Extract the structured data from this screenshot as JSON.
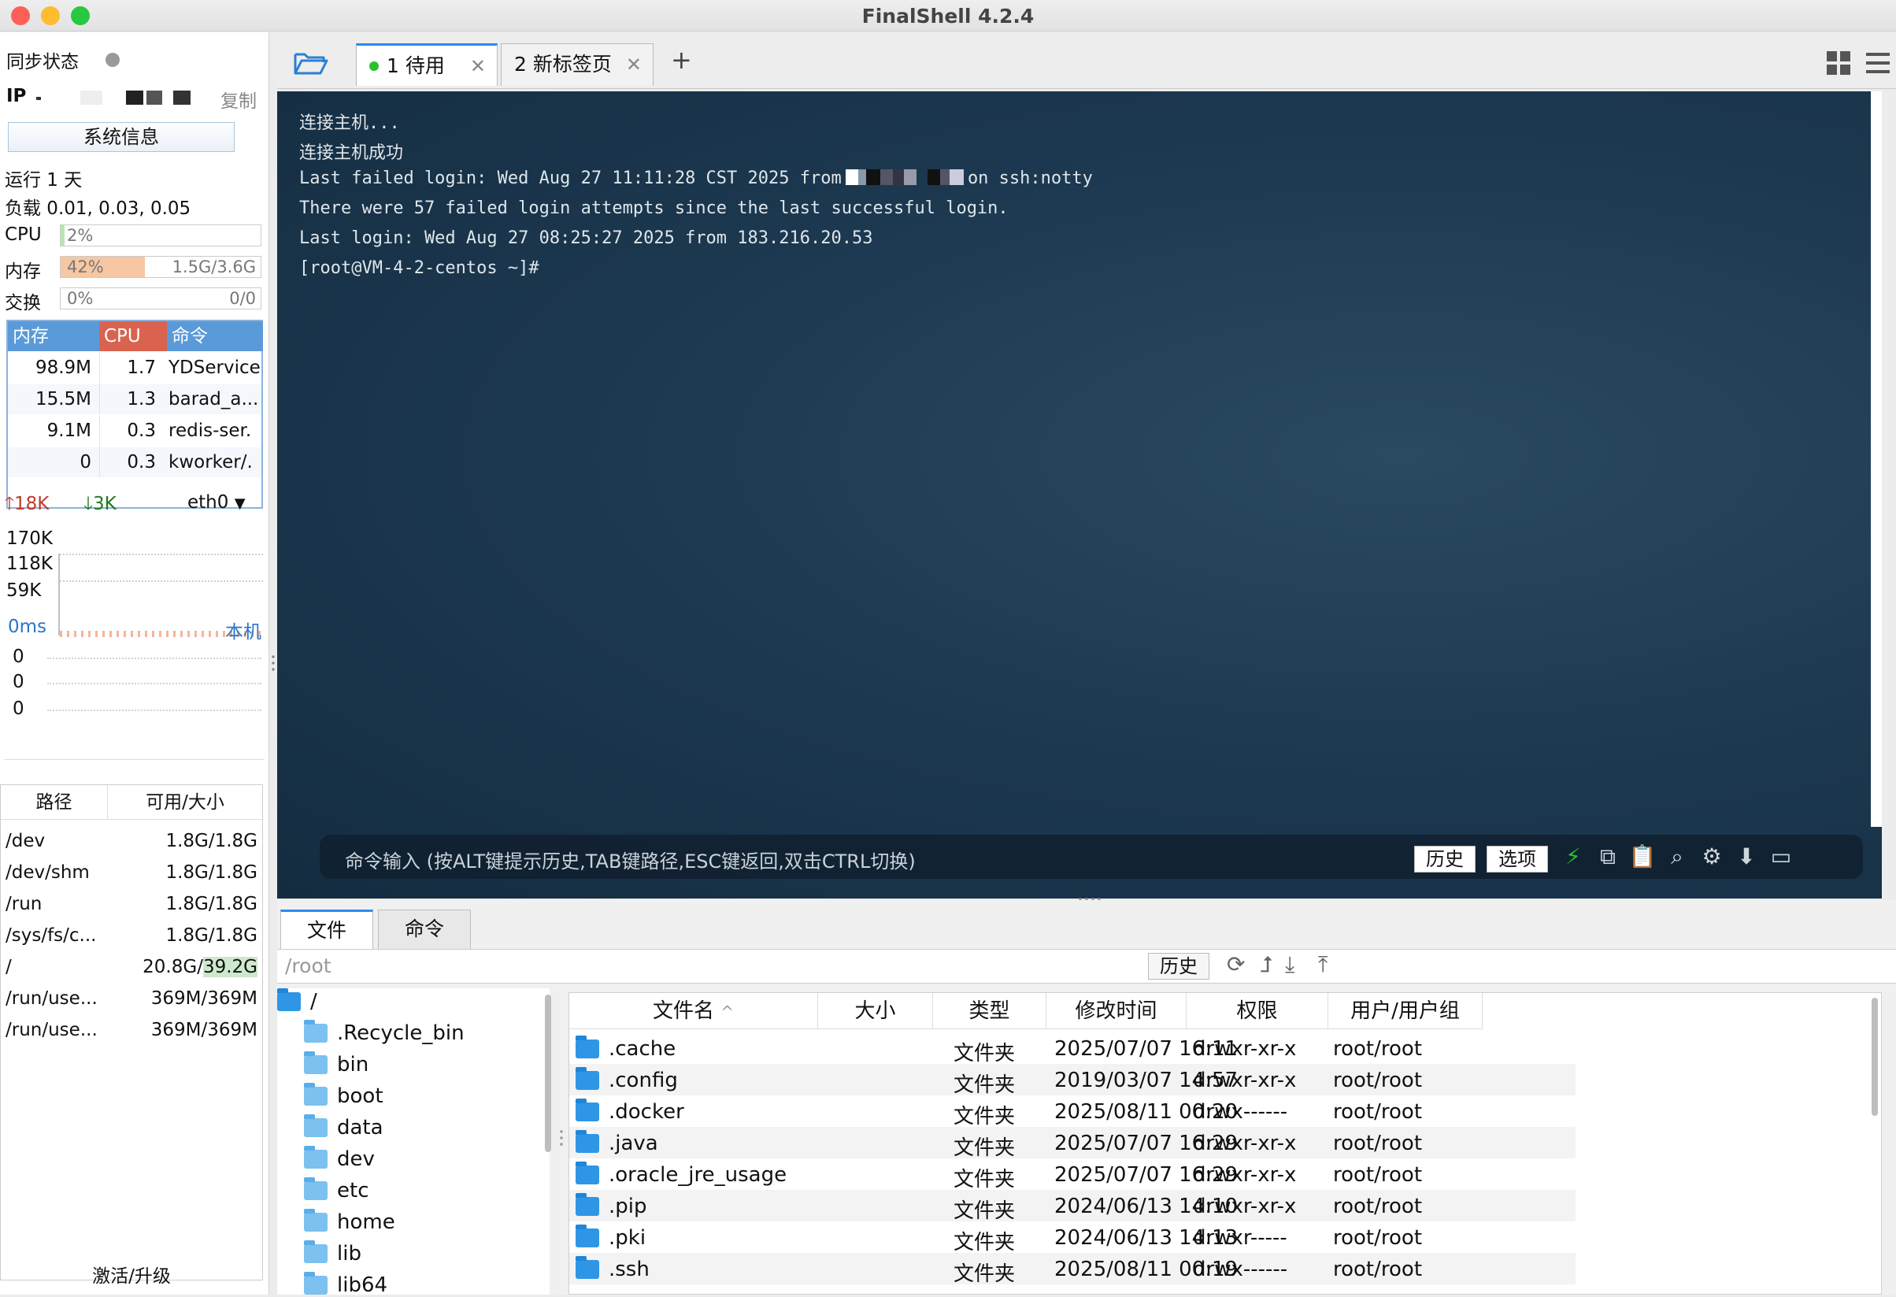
{
  "window": {
    "title": "FinalShell 4.2.4"
  },
  "sidebar": {
    "sync_label": "同步状态",
    "ip_label": "IP",
    "copy_label": "复制",
    "sysinfo_label": "系统信息",
    "uptime": "运行 1 天",
    "load": "负载 0.01, 0.03, 0.05",
    "cpu": {
      "label": "CPU",
      "value": "2%",
      "fraction": 0.02
    },
    "mem": {
      "label": "内存",
      "value": "42%",
      "detail": "1.5G/3.6G",
      "fraction": 0.42
    },
    "swap": {
      "label": "交换",
      "value": "0%",
      "detail": "0/0",
      "fraction": 0
    },
    "process_table": {
      "headers": [
        "内存",
        "CPU",
        "命令"
      ],
      "rows": [
        {
          "mem": "98.9M",
          "cpu": "1.7",
          "cmd": "YDService"
        },
        {
          "mem": "15.5M",
          "cpu": "1.3",
          "cmd": "barad_a..."
        },
        {
          "mem": "9.1M",
          "cpu": "0.3",
          "cmd": "redis-ser."
        },
        {
          "mem": "0",
          "cpu": "0.3",
          "cmd": "kworker/."
        }
      ]
    },
    "net": {
      "up": "18K",
      "down": "3K",
      "iface": "eth0",
      "scale": [
        "170K",
        "118K",
        "59K"
      ]
    },
    "ping": {
      "latency": "0ms",
      "target": "本机",
      "values": [
        "0",
        "0",
        "0"
      ]
    },
    "disk_table": {
      "headers": [
        "路径",
        "可用/大小"
      ],
      "rows": [
        {
          "path": "/dev",
          "size": "1.8G/1.8G"
        },
        {
          "path": "/dev/shm",
          "size": "1.8G/1.8G"
        },
        {
          "path": "/run",
          "size": "1.8G/1.8G"
        },
        {
          "path": "/sys/fs/c...",
          "size": "1.8G/1.8G"
        },
        {
          "path": "/",
          "size_a": "20.8G/",
          "size_b": "39.2G"
        },
        {
          "path": "/run/use...",
          "size": "369M/369M"
        },
        {
          "path": "/run/use...",
          "size": "369M/369M"
        }
      ]
    },
    "activate_label": "激活/升级"
  },
  "tabs": [
    {
      "label": "1 待用"
    },
    {
      "label": "2 新标签页"
    }
  ],
  "terminal": {
    "lines": [
      "连接主机...",
      "连接主机成功",
      "Last failed login: Wed Aug 27 11:11:28 CST 2025 from",
      "on ssh:notty",
      "There were 57 failed login attempts since the last successful login.",
      "Last login: Wed Aug 27 08:25:27 2025 from 183.216.20.53",
      "[root@VM-4-2-centos ~]#"
    ],
    "command_placeholder": "命令输入 (按ALT键提示历史,TAB键路径,ESC键返回,双击CTRL切换)",
    "history_button": "历史",
    "options_button": "选项"
  },
  "bottom": {
    "tabs": [
      "文件",
      "命令"
    ],
    "path": "/root",
    "history_button": "历史",
    "tree": [
      {
        "name": "/"
      },
      {
        "name": ".Recycle_bin"
      },
      {
        "name": "bin"
      },
      {
        "name": "boot"
      },
      {
        "name": "data"
      },
      {
        "name": "dev"
      },
      {
        "name": "etc"
      },
      {
        "name": "home"
      },
      {
        "name": "lib"
      },
      {
        "name": "lib64"
      }
    ],
    "file_headers": [
      "文件名",
      "大小",
      "类型",
      "修改时间",
      "权限",
      "用户/用户组"
    ],
    "files": [
      {
        "name": ".cache",
        "size": "",
        "type": "文件夹",
        "mtime": "2025/07/07 16:11",
        "perm": "drwxr-xr-x",
        "owner": "root/root"
      },
      {
        "name": ".config",
        "size": "",
        "type": "文件夹",
        "mtime": "2019/03/07 14:57",
        "perm": "drwxr-xr-x",
        "owner": "root/root"
      },
      {
        "name": ".docker",
        "size": "",
        "type": "文件夹",
        "mtime": "2025/08/11 00:20",
        "perm": "drwx------",
        "owner": "root/root"
      },
      {
        "name": ".java",
        "size": "",
        "type": "文件夹",
        "mtime": "2025/07/07 16:29",
        "perm": "drwxr-xr-x",
        "owner": "root/root"
      },
      {
        "name": ".oracle_jre_usage",
        "size": "",
        "type": "文件夹",
        "mtime": "2025/07/07 16:29",
        "perm": "drwxr-xr-x",
        "owner": "root/root"
      },
      {
        "name": ".pip",
        "size": "",
        "type": "文件夹",
        "mtime": "2024/06/13 14:10",
        "perm": "drwxr-xr-x",
        "owner": "root/root"
      },
      {
        "name": ".pki",
        "size": "",
        "type": "文件夹",
        "mtime": "2024/06/13 14:13",
        "perm": "drwxr-----",
        "owner": "root/root"
      },
      {
        "name": ".ssh",
        "size": "",
        "type": "文件夹",
        "mtime": "2025/08/11 00:19",
        "perm": "drwx------",
        "owner": "root/root"
      }
    ]
  },
  "colors": {
    "accent": "#2b8af0",
    "mem_fill": "#f6c7a2",
    "proc_mem_hd": "#5a9ad8",
    "proc_cpu_hd": "#d9634f",
    "proc_cmd_hd": "#5a9ad8",
    "status_green": "#2bc02b"
  }
}
